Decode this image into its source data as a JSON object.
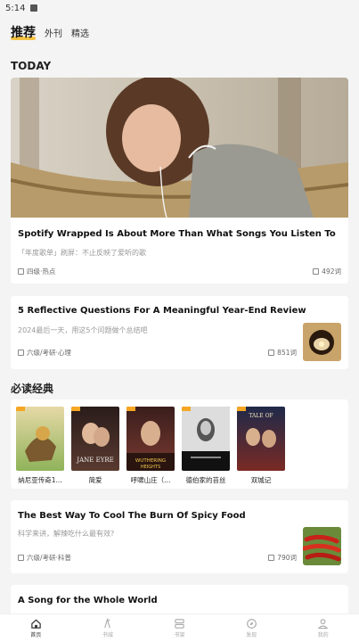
{
  "status_bar": {
    "time": "5:14"
  },
  "tabs": [
    {
      "label": "推荐"
    },
    {
      "label": "外刊"
    },
    {
      "label": "精选"
    }
  ],
  "today_label": "TODAY",
  "articles": [
    {
      "title": "Spotify Wrapped Is About More Than What Songs You Listen To",
      "subtitle": "「年度歌单」刷屏：不止反映了爱听的歌",
      "level": "四级·热点",
      "words": "492词"
    },
    {
      "title": "5 Reflective Questions For A Meaningful Year-End Review",
      "subtitle": "2024最后一天，用这5个问题做个总结吧",
      "level": "六级/考研·心理",
      "words": "851词"
    },
    {
      "title": "The Best Way To Cool The Burn Of Spicy Food",
      "subtitle": "科学来讲，解辣吃什么最有效?",
      "level": "六级/考研·科普",
      "words": "790词"
    },
    {
      "title": "A Song for the Whole World"
    }
  ],
  "classics_title": "必读经典",
  "books": [
    {
      "name": "纳尼亚传奇1...",
      "cover_color": "#a8c46a"
    },
    {
      "name": "简爱",
      "cover_color": "#3a2a28"
    },
    {
      "name": "呼啸山庄（...",
      "cover_color": "#5a2b2a"
    },
    {
      "name": "德伯家的苔丝",
      "cover_color": "#222222"
    },
    {
      "name": "双城记",
      "cover_color": "#6b1e1e"
    }
  ],
  "bottom_nav": [
    {
      "label": "首页",
      "icon": "home-icon"
    },
    {
      "label": "书城",
      "icon": "book-icon"
    },
    {
      "label": "书架",
      "icon": "shelf-icon"
    },
    {
      "label": "发现",
      "icon": "compass-icon"
    },
    {
      "label": "我的",
      "icon": "user-icon"
    }
  ],
  "colors": {
    "accent": "#f6c343",
    "tag": "#f6a623"
  }
}
